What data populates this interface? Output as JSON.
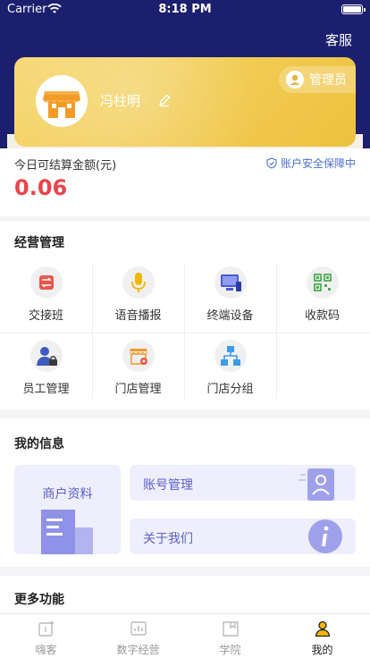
{
  "status_bar": {
    "carrier": "Carrier",
    "time": "8:18 PM"
  },
  "header": {
    "service_label": "客服"
  },
  "member_card": {
    "username": "冯柱明",
    "role": "管理员"
  },
  "balance": {
    "label": "今日可结算金额(元)",
    "security": "账户安全保障中",
    "amount": "0.06"
  },
  "business": {
    "title": "经营管理",
    "items": [
      {
        "label": "交接班",
        "icon": "shift-handover-icon"
      },
      {
        "label": "语音播报",
        "icon": "microphone-icon"
      },
      {
        "label": "终端设备",
        "icon": "terminal-device-icon"
      },
      {
        "label": "收款码",
        "icon": "qr-code-icon"
      },
      {
        "label": "员工管理",
        "icon": "staff-icon"
      },
      {
        "label": "门店管理",
        "icon": "store-settings-icon"
      },
      {
        "label": "门店分组",
        "icon": "org-chart-icon"
      }
    ]
  },
  "my_info": {
    "title": "我的信息",
    "merchant": "商户资料",
    "account": "账号管理",
    "about": "关于我们"
  },
  "more": {
    "title": "更多功能"
  },
  "tabs": [
    {
      "label": "嗨客",
      "icon": "hike-icon",
      "active": false
    },
    {
      "label": "数字经营",
      "icon": "chart-icon",
      "active": false
    },
    {
      "label": "学院",
      "icon": "book-icon",
      "active": false
    },
    {
      "label": "我的",
      "icon": "user-icon",
      "active": true
    }
  ],
  "colors": {
    "header_bg": "#1c1f6e",
    "card_gold": "#f1cb52",
    "amount_red": "#e8454a",
    "accent_purple": "#5b5fc7",
    "tab_active": "#f2b705"
  }
}
